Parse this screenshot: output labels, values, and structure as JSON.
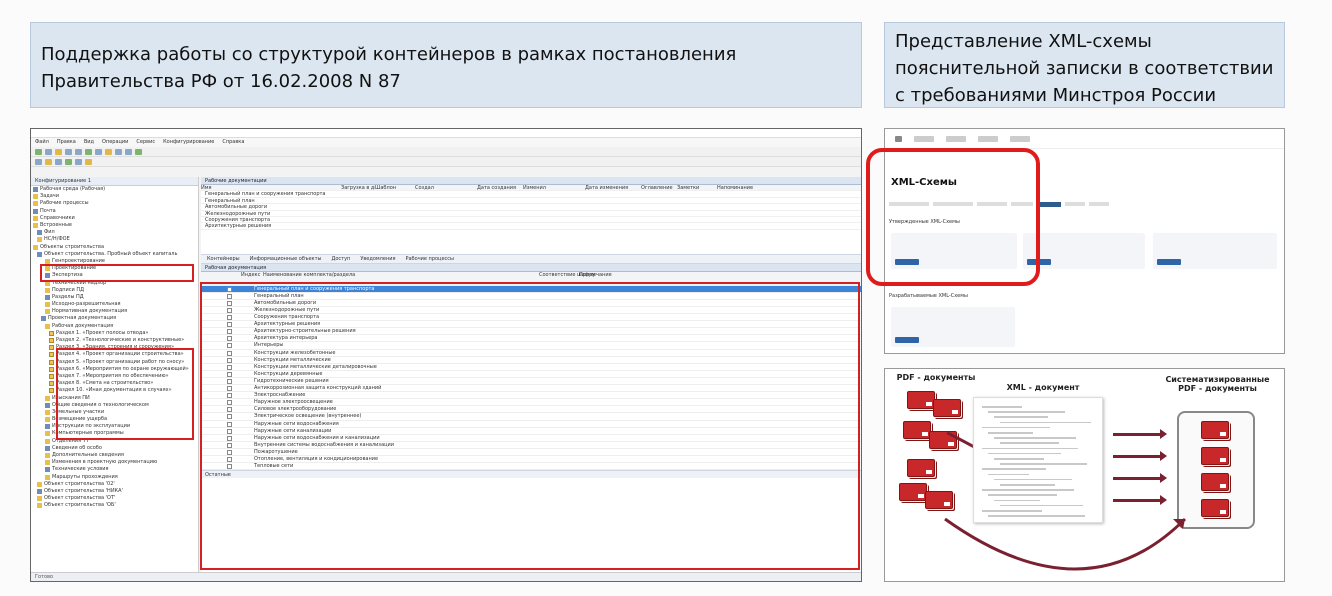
{
  "titles": {
    "left_line1": "Поддержка работы со структурой контейнеров в рамках постановления",
    "left_line2": "Правительства РФ от 16.02.2008 N 87",
    "right_line1": "Представление XML-схемы",
    "right_line2": "пояснительной записки в соответствии",
    "right_line3": "с требованиями Минстроя России"
  },
  "app": {
    "menu": [
      "Файл",
      "Правка",
      "Вид",
      "Операции",
      "Сервис",
      "Конфигурирование",
      "Справка"
    ],
    "tree_tab": "Конфигурирование 1",
    "left_pane_title": "Рабочие документации",
    "bottom_pane_title": "Рабочая документация",
    "tabs": [
      "Контейнеры",
      "Информационные объекты",
      "Доступ",
      "Уведомления",
      "Рабочие процессы"
    ],
    "tree": [
      "Рабочая среда (Рабочая)",
      "Задачи",
      "Рабочие процессы",
      "Почта",
      "Справочники",
      "Встроенные",
      "Фил",
      "HC/H/ФОЕ",
      "Объекты строительства",
      "Объект строительства. Пробный объект капиталь",
      "Генпроектирование",
      "Проектирование",
      "Экспертиза",
      "Технический надзор",
      "Подписи ПД",
      "Разделы ПД",
      "Исходно-разрешительная",
      "Нормативная документация",
      "Проектная документация",
      "Рабочая документация",
      "Раздел 1. «Проект полосы отвода»",
      "Раздел 2. «Технологические и конструктивные»",
      "Раздел 3. «Здания, строения и сооружения»",
      "Раздел 4. «Проект организации строительства»",
      "Раздел 5. «Проект организации работ по сносу»",
      "Раздел 6. «Мероприятия по охране окружающей»",
      "Раздел 7. «Мероприятия по обеспечению»",
      "Раздел 8. «Смета на строительство»",
      "Раздел 10. «Иная документация в случаях»",
      "Изыскания ПИ",
      "Общие сведения о технологическом",
      "Земельные участки",
      "Возмещение ущерба",
      "Инструкции по эксплуатации",
      "Компьютерные программы",
      "Отделения ТТ",
      "Сведения об особо",
      "Дополнительные сведения",
      "Изменения в проектную документацию",
      "Технические условия",
      "Маршруты прохождения",
      "Объект строительства '02'",
      "Объект строительства 'НИКА'",
      "Объект строительства 'ОТ'",
      "Объект строительства 'ОБ'"
    ],
    "grid_header": [
      "Имя",
      "Загрузка в днях",
      "Шаблон",
      "Создал",
      "Дата создания",
      "Изменил",
      "Дата изменения",
      "Оглавление",
      "Заметки",
      "Напоминание"
    ],
    "grid_rows": [
      "Генеральный план и сооружения транспорта",
      "Генеральный план",
      "Автомобильные дороги",
      "Железнодорожные пути",
      "Сооружения транспорта",
      "Архитектурные решения"
    ],
    "doc_header": [
      "Индекс",
      "Наименование комплекта/раздела",
      "Соответствие шифру",
      "Примечание"
    ],
    "doc_rows": [
      "Генеральный план и сооружения транспорта",
      "Генеральный план",
      "Автомобильные дороги",
      "Железнодорожные пути",
      "Сооружения транспорта",
      "Архитектурные решения",
      "Архитектурно-строительные решения",
      "Архитектура интерьера",
      "Интерьеры",
      "Конструкции железобетонные",
      "Конструкции металлические",
      "Конструкции металлические деталировочные",
      "Конструкции деревянные",
      "Гидротехнические решения",
      "Антикоррозионная защита конструкций зданий",
      "Электроснабжение",
      "Наружное электроосвещение",
      "Силовое электрооборудование",
      "Электрическое освещение (внутреннее)",
      "Наружные сети водоснабжения",
      "Наружные сети канализации",
      "Наружные сети водоснабжения и канализации",
      "Внутренние системы водоснабжения и канализации",
      "Пожаротушение",
      "Отопление, вентиляция и кондиционирование",
      "Тепловые сети"
    ],
    "bottom_tab": "Остатные",
    "status": "Готово"
  },
  "xml_page": {
    "heading": "XML-Схемы",
    "subheading_approved": "Утвержденные XML-Схемы",
    "subheading_developing": "Разрабатываемые XML-Схемы"
  },
  "diagram": {
    "pdf_docs": "PDF - документы",
    "xml_doc": "XML - документ",
    "sys_line1": "Систематизированные",
    "sys_line2": "PDF - документы"
  },
  "colors": {
    "title_bg": "#dce6f1",
    "highlight_red": "#e01b1b",
    "book_red": "#c8282a",
    "selection_blue": "#3c84d8"
  }
}
